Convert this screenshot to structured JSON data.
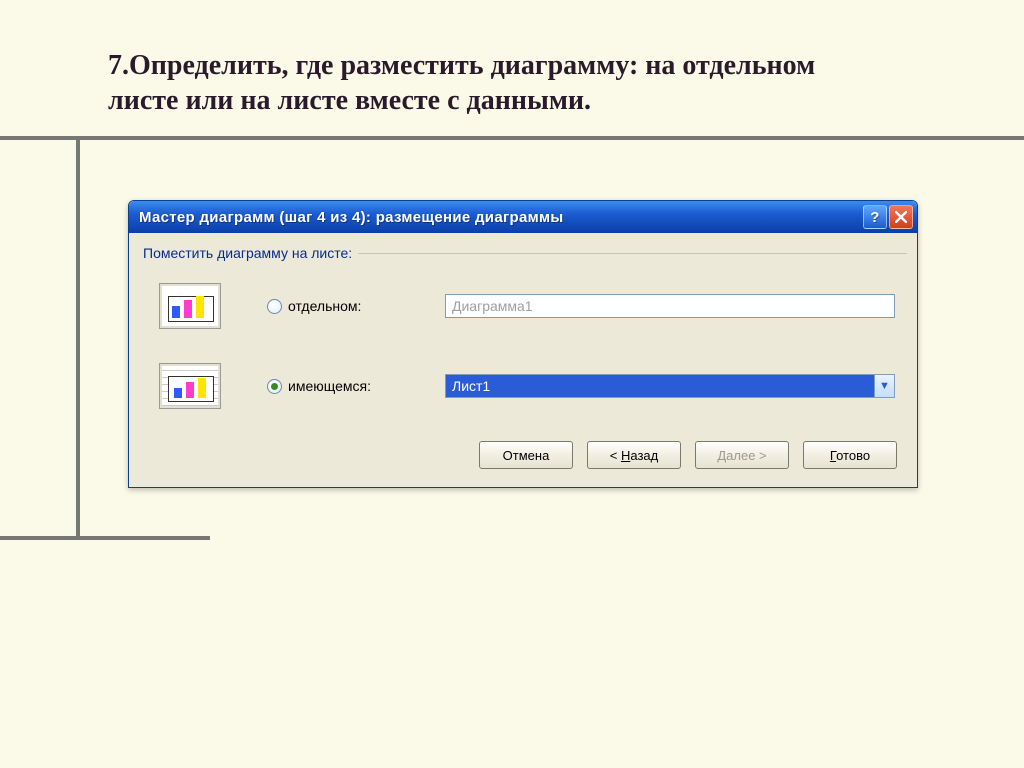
{
  "slide": {
    "title": "7.Определить, где разместить диаграмму: на отдельном листе или на листе вместе с данными."
  },
  "dialog": {
    "title": "Мастер диаграмм (шаг 4 из 4): размещение диаграммы",
    "group_label": "Поместить диаграмму на листе:",
    "option_separate": {
      "label": "отдельном:",
      "value": "Диаграмма1",
      "checked": false
    },
    "option_existing": {
      "label": "имеющемся:",
      "value": "Лист1",
      "checked": true
    },
    "buttons": {
      "cancel": "Отмена",
      "back_prefix": "< ",
      "back_ul": "Н",
      "back_rest": "азад",
      "next": "Далее >",
      "finish_ul": "Г",
      "finish_rest": "отово"
    }
  }
}
